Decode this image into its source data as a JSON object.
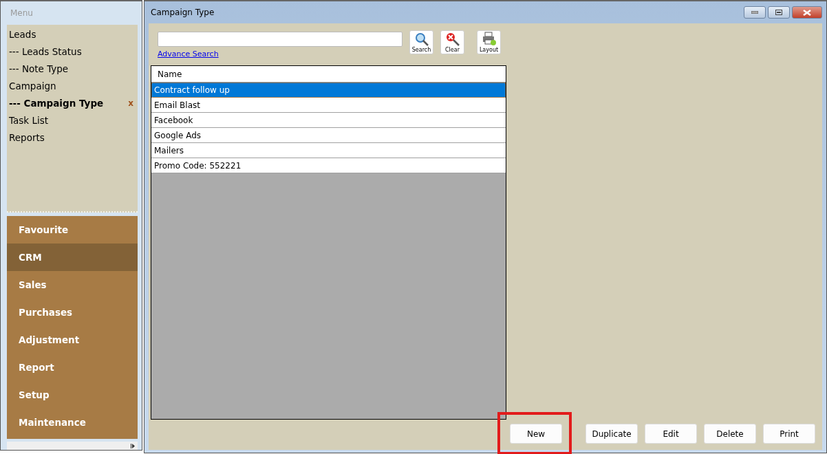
{
  "menu": {
    "title": "Menu",
    "items": [
      {
        "label": "Leads",
        "selected": false
      },
      {
        "label": "--- Leads Status",
        "selected": false
      },
      {
        "label": "--- Note Type",
        "selected": false
      },
      {
        "label": "Campaign",
        "selected": false
      },
      {
        "label": "--- Campaign Type",
        "selected": true,
        "close_label": "x"
      },
      {
        "label": "Task List",
        "selected": false
      },
      {
        "label": "Reports",
        "selected": false
      }
    ],
    "sections": [
      {
        "label": "Favourite",
        "selected": false
      },
      {
        "label": "CRM",
        "selected": true
      },
      {
        "label": "Sales",
        "selected": false
      },
      {
        "label": "Purchases",
        "selected": false
      },
      {
        "label": "Adjustment",
        "selected": false
      },
      {
        "label": "Report",
        "selected": false
      },
      {
        "label": "Setup",
        "selected": false
      },
      {
        "label": "Maintenance",
        "selected": false
      }
    ]
  },
  "window": {
    "title": "Campaign Type"
  },
  "search": {
    "advance_link": "Advance Search",
    "tools": [
      {
        "kind": "search",
        "label": "Search"
      },
      {
        "kind": "clear",
        "label": "Clear"
      },
      {
        "kind": "layout",
        "label": "Layout"
      }
    ]
  },
  "table": {
    "columns": [
      "Name"
    ],
    "rows": [
      {
        "name": "Contract follow up",
        "selected": true
      },
      {
        "name": "Email Blast",
        "selected": false
      },
      {
        "name": "Facebook",
        "selected": false
      },
      {
        "name": "Google Ads",
        "selected": false
      },
      {
        "name": "Mailers",
        "selected": false
      },
      {
        "name": "Promo Code: 552221",
        "selected": false
      }
    ]
  },
  "buttons": [
    {
      "label": "New",
      "highlighted": true
    },
    {
      "label": "Duplicate",
      "highlighted": false
    },
    {
      "label": "Edit",
      "highlighted": false
    },
    {
      "label": "Delete",
      "highlighted": false
    },
    {
      "label": "Print",
      "highlighted": false
    }
  ]
}
